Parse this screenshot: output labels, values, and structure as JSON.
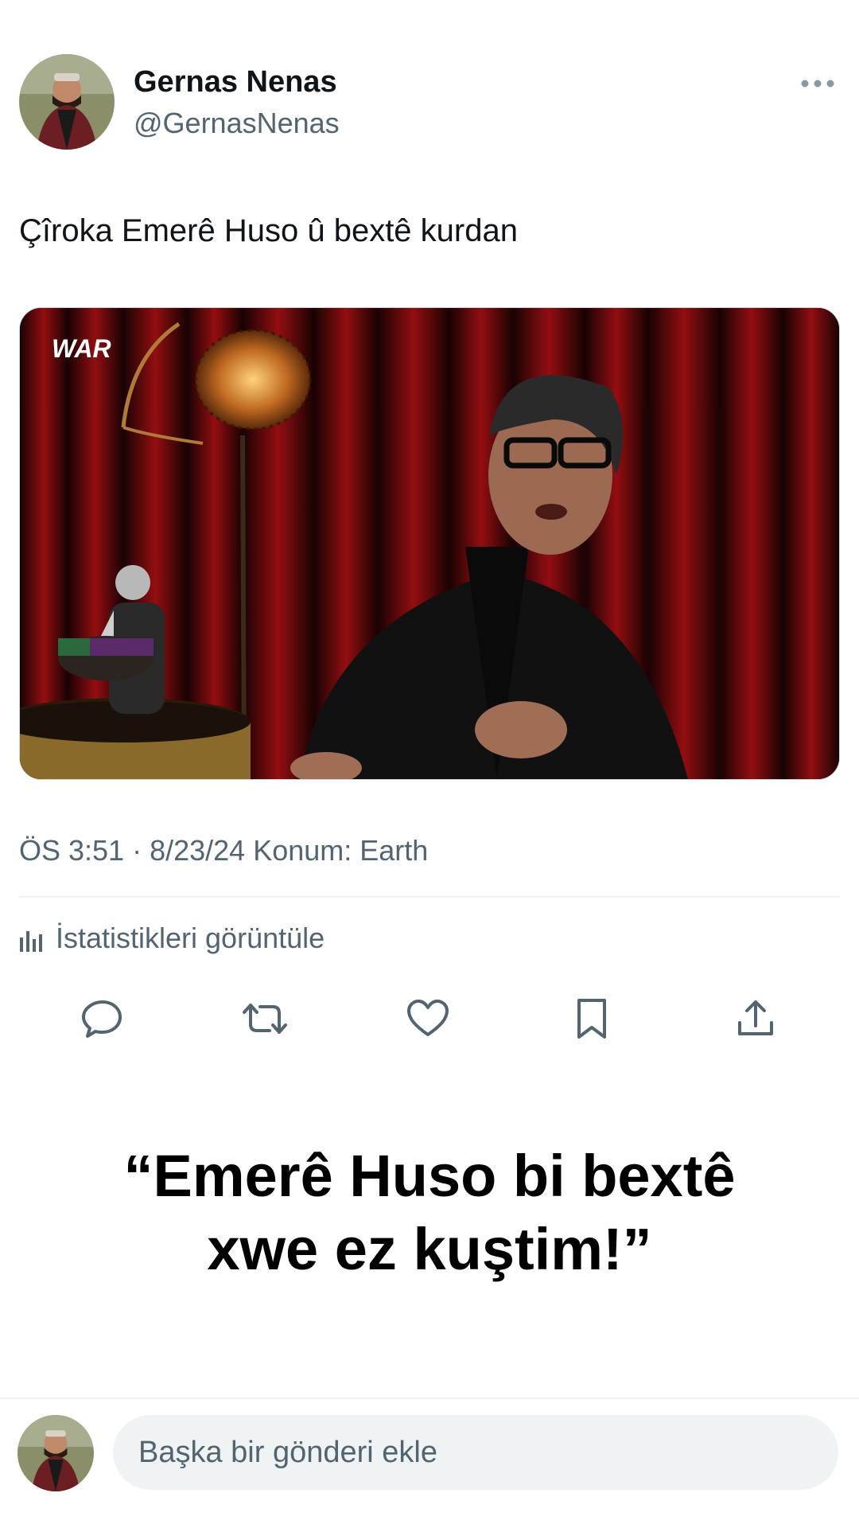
{
  "author": {
    "display_name": "Gernas Nenas",
    "handle": "@GernasNenas",
    "avatar_icon": "person-avatar-icon"
  },
  "tweet": {
    "text": "Çîroka Emerê Huso û bextê kurdan",
    "media_logo": "WAR",
    "meta": "ÖS 3:51 · 8/23/24 Konum: Earth",
    "stats_label": "İstatistikleri görüntüle"
  },
  "actions": {
    "icons": [
      "reply-icon",
      "retweet-icon",
      "like-icon",
      "bookmark-icon",
      "share-icon"
    ]
  },
  "caption": {
    "line1": "“Emerê Huso bi bextê",
    "line2": "xwe ez kuştim!”"
  },
  "composer": {
    "placeholder": "Başka bir gönderi ekle"
  },
  "colors": {
    "text_primary": "#0f1419",
    "text_secondary": "#536471",
    "divider": "#eff3f4",
    "input_bg": "#eff3f4"
  }
}
